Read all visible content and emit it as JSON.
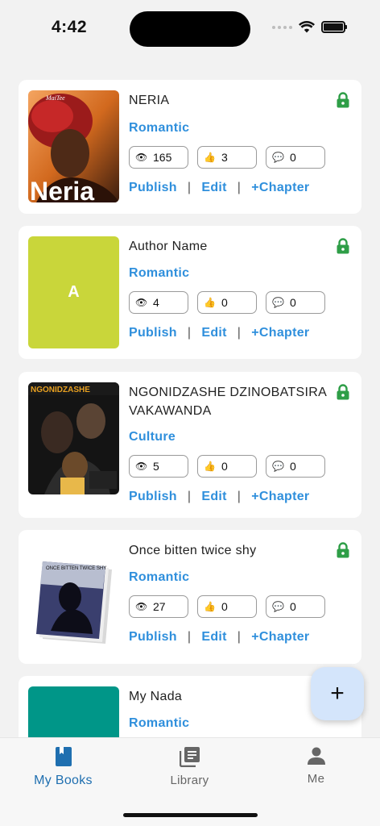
{
  "status_bar": {
    "time": "4:42"
  },
  "books": [
    {
      "title": "NERIA",
      "genre": "Romantic",
      "views": "165",
      "likes": "3",
      "comments": "0",
      "cover_type": "image",
      "cover_text": "Neria",
      "cover_caption": "MaiTee"
    },
    {
      "title": "Author Name",
      "genre": "Romantic",
      "views": "4",
      "likes": "0",
      "comments": "0",
      "cover_type": "letter",
      "cover_letter": "A",
      "cover_color": "#c9d63a"
    },
    {
      "title": "NGONIDZASHE DZINOBATSIRA VAKAWANDA",
      "genre": "Culture",
      "views": "5",
      "likes": "0",
      "comments": "0",
      "cover_type": "image",
      "cover_text": "NGONIDZASHE"
    },
    {
      "title": "Once bitten twice shy",
      "genre": "Romantic",
      "views": "27",
      "likes": "0",
      "comments": "0",
      "cover_type": "image",
      "cover_text": "ONCE BITTEN TWICE SHY"
    },
    {
      "title": "My Nada",
      "genre": "Romantic",
      "cover_type": "color",
      "cover_color": "#009688"
    }
  ],
  "actions": {
    "publish": "Publish",
    "edit": "Edit",
    "add_chapter": "+Chapter",
    "separator": "|"
  },
  "fab": {
    "label": "+"
  },
  "nav": [
    {
      "label": "My Books",
      "icon": "book-icon",
      "active": true
    },
    {
      "label": "Library",
      "icon": "library-icon",
      "active": false
    },
    {
      "label": "Me",
      "icon": "person-icon",
      "active": false
    }
  ],
  "colors": {
    "accent": "#2f8fdc",
    "lock": "#2e9e47",
    "nav_active": "#1f6fb0",
    "fab_bg": "#d4e5fb"
  }
}
